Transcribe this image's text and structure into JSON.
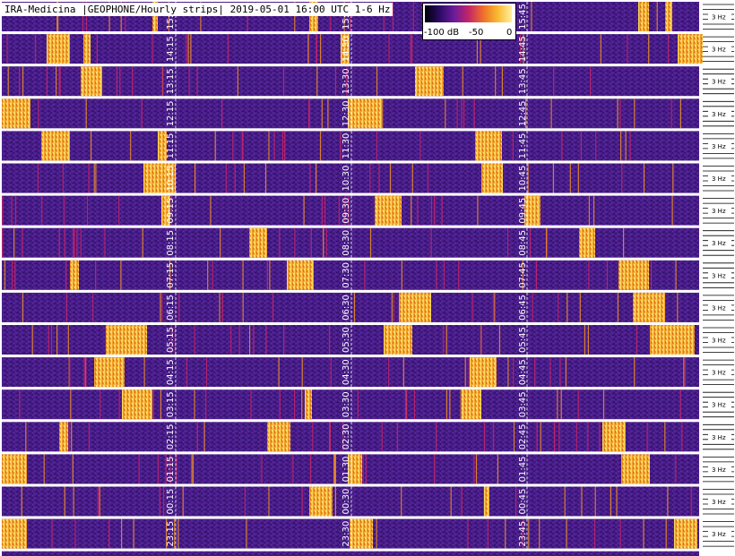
{
  "title": "IRA-Medicina |GEOPHONE/Hourly strips| 2019-05-01 16:00 UTC 1-6 Hz",
  "colorbar": {
    "min_label": "-100 dB",
    "mid_label": "-50",
    "max_label": "0",
    "colors": [
      "#000004",
      "#2a0b64",
      "#6a1b9a",
      "#c2246b",
      "#ef6d2b",
      "#f8b82e",
      "#fff0a0"
    ]
  },
  "chart_data": {
    "type": "heatmap",
    "title": "IRA-Medicina |GEOPHONE/Hourly strips| 2019-05-01 16:00 UTC 1-6 Hz",
    "color_range_db": [
      -100,
      0
    ],
    "frequency_range_hz": [
      1,
      6
    ],
    "y_tick_label": "3 Hz",
    "strips": [
      {
        "labels": [
          "15:15",
          "15:30",
          "15:45"
        ],
        "events": [
          [
            170,
            6
          ],
          [
            345,
            10
          ],
          [
            560,
            0
          ],
          [
            712,
            12
          ],
          [
            742,
            8
          ]
        ]
      },
      {
        "labels": [
          "14:15",
          "14:30",
          "14:45"
        ],
        "events": [
          [
            52,
            26
          ],
          [
            93,
            8
          ],
          [
            380,
            10
          ],
          [
            756,
            28
          ]
        ]
      },
      {
        "labels": [
          "13:15",
          "13:30",
          "13:45"
        ],
        "events": [
          [
            90,
            24
          ],
          [
            463,
            32
          ]
        ]
      },
      {
        "labels": [
          "12:15",
          "12:30",
          "12:45"
        ],
        "events": [
          [
            2,
            32
          ],
          [
            388,
            38
          ]
        ]
      },
      {
        "labels": [
          "11:15",
          "11:30",
          "11:45"
        ],
        "events": [
          [
            46,
            32
          ],
          [
            176,
            10
          ],
          [
            530,
            30
          ]
        ]
      },
      {
        "labels": [
          "10:15",
          "10:30",
          "10:45"
        ],
        "events": [
          [
            160,
            36
          ],
          [
            537,
            24
          ]
        ]
      },
      {
        "labels": [
          "09:15",
          "09:30",
          "09:45"
        ],
        "events": [
          [
            180,
            10
          ],
          [
            418,
            30
          ],
          [
            585,
            18
          ]
        ]
      },
      {
        "labels": [
          "08:15",
          "08:30",
          "08:45"
        ],
        "events": [
          [
            278,
            20
          ],
          [
            646,
            18
          ]
        ]
      },
      {
        "labels": [
          "07:15",
          "07:30",
          "07:45"
        ],
        "events": [
          [
            78,
            10
          ],
          [
            320,
            30
          ],
          [
            690,
            34
          ]
        ]
      },
      {
        "labels": [
          "06:15",
          "06:30",
          "06:45"
        ],
        "events": [
          [
            445,
            36
          ],
          [
            706,
            36
          ]
        ]
      },
      {
        "labels": [
          "05:15",
          "05:30",
          "05:45"
        ],
        "events": [
          [
            118,
            46
          ],
          [
            428,
            32
          ],
          [
            725,
            50
          ]
        ]
      },
      {
        "labels": [
          "04:15",
          "04:30",
          "04:45"
        ],
        "events": [
          [
            105,
            34
          ],
          [
            524,
            30
          ]
        ]
      },
      {
        "labels": [
          "03:15",
          "03:30",
          "03:45"
        ],
        "events": [
          [
            136,
            34
          ],
          [
            340,
            8
          ],
          [
            515,
            22
          ]
        ]
      },
      {
        "labels": [
          "02:15",
          "02:30",
          "02:45"
        ],
        "events": [
          [
            66,
            10
          ],
          [
            298,
            26
          ],
          [
            672,
            26
          ]
        ]
      },
      {
        "labels": [
          "01:15",
          "01:30",
          "01:45"
        ],
        "events": [
          [
            2,
            28
          ],
          [
            388,
            16
          ],
          [
            693,
            32
          ]
        ]
      },
      {
        "labels": [
          "00:15",
          "00:30",
          "00:45"
        ],
        "events": [
          [
            345,
            26
          ],
          [
            540,
            6
          ]
        ]
      },
      {
        "labels": [
          "23:15",
          "23:30",
          "23:45"
        ],
        "events": [
          [
            2,
            28
          ],
          [
            390,
            26
          ],
          [
            752,
            26
          ]
        ]
      }
    ]
  }
}
